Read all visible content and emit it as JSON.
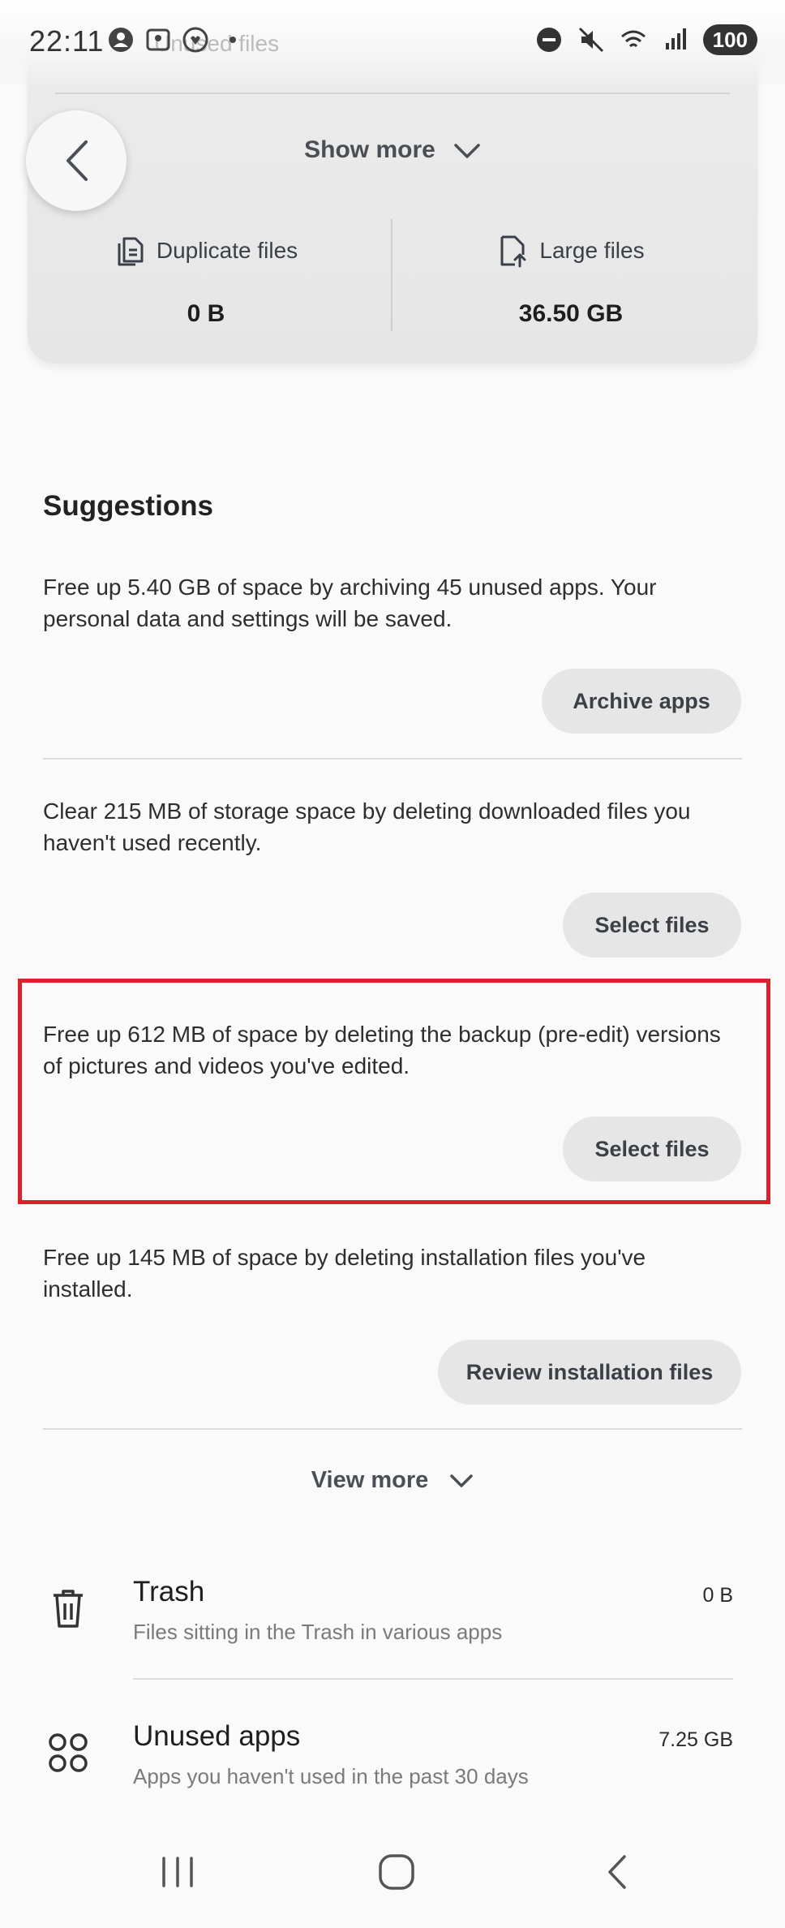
{
  "status_bar": {
    "time": "22:11",
    "faded_title": "Unused files",
    "battery": "100",
    "icons": [
      "account-icon",
      "gallery-icon",
      "health-icon",
      "dot-icon",
      "do-not-disturb-icon",
      "mute-icon",
      "wifi-icon",
      "signal-icon"
    ]
  },
  "top_card": {
    "show_more": "Show more",
    "duplicate_label": "Duplicate files",
    "duplicate_value": "0 B",
    "large_label": "Large files",
    "large_value": "36.50 GB"
  },
  "suggestions": {
    "title": "Suggestions",
    "items": [
      {
        "text": "Free up 5.40 GB of space by archiving 45 unused apps. Your personal data and settings will be saved.",
        "button": "Archive apps"
      },
      {
        "text": "Clear 215 MB of storage space by deleting downloaded files you haven't used recently.",
        "button": "Select files"
      },
      {
        "text": "Free up 612 MB of space by deleting the backup (pre-edit) versions of pictures and videos you've edited.",
        "button": "Select files"
      },
      {
        "text": "Free up 145 MB of space by deleting installation files you've installed.",
        "button": "Review installation files"
      }
    ],
    "view_more": "View more"
  },
  "list": [
    {
      "title": "Trash",
      "subtitle": "Files sitting in the Trash in various apps",
      "size": "0 B",
      "icon": "trash-icon"
    },
    {
      "title": "Unused apps",
      "subtitle": "Apps you haven't used in the past 30 days",
      "size": "7.25 GB",
      "icon": "apps-grid-icon"
    }
  ],
  "colors": {
    "highlight": "#d8222e",
    "pill_bg": "#e6e6e6",
    "card_bg": "#e9e9e9"
  }
}
